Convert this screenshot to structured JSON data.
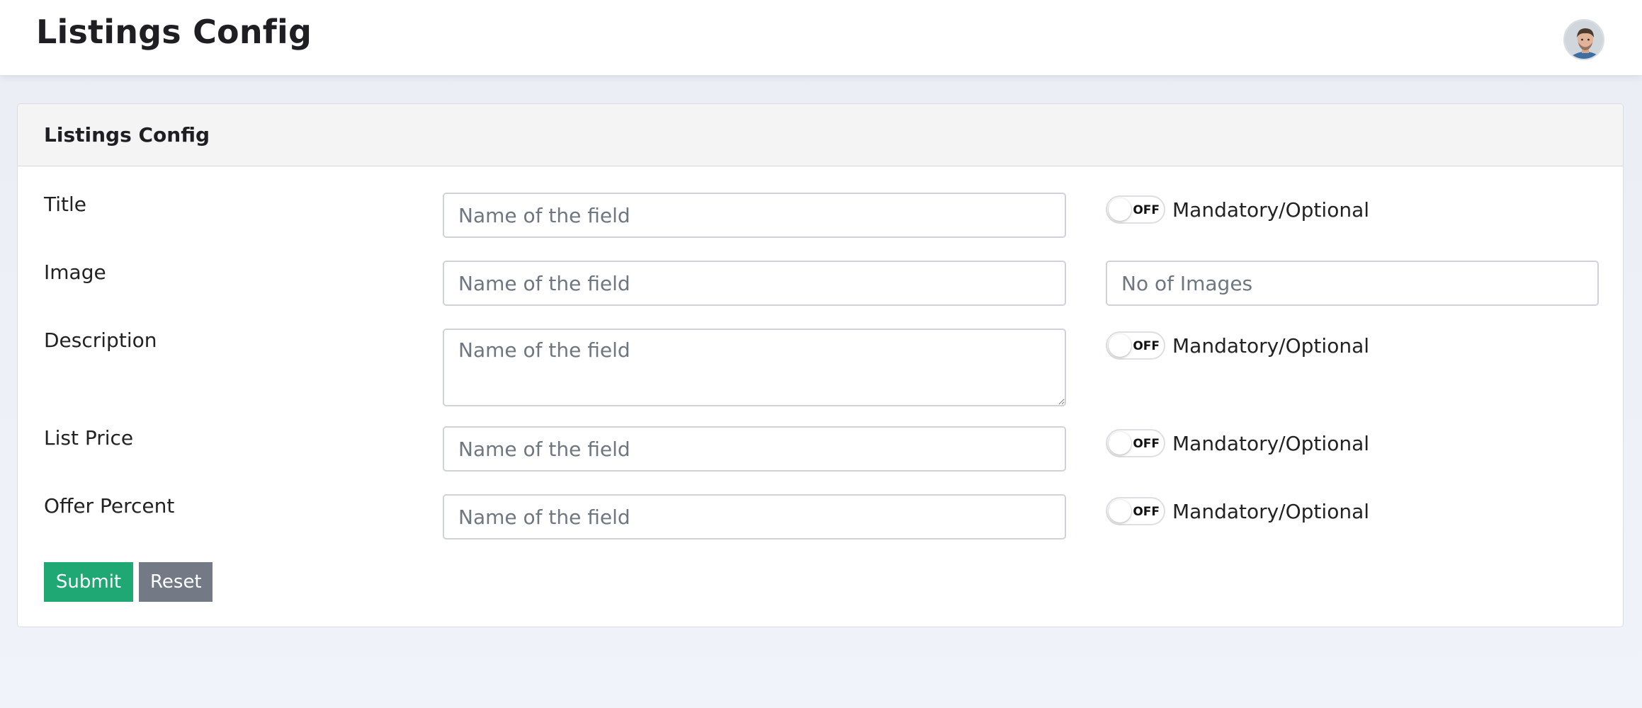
{
  "header": {
    "title": "Listings Config"
  },
  "card": {
    "title": "Listings Config"
  },
  "form": {
    "rows": [
      {
        "label": "Title",
        "placeholder": "Name of the field",
        "toggle_state": "OFF",
        "toggle_label": "Mandatory/Optional"
      },
      {
        "label": "Image",
        "placeholder": "Name of the field",
        "images_placeholder": "No of Images"
      },
      {
        "label": "Description",
        "placeholder": "Name of the field",
        "toggle_state": "OFF",
        "toggle_label": "Mandatory/Optional"
      },
      {
        "label": "List Price",
        "placeholder": "Name of the field",
        "toggle_state": "OFF",
        "toggle_label": "Mandatory/Optional"
      },
      {
        "label": "Offer Percent",
        "placeholder": "Name of the field",
        "toggle_state": "OFF",
        "toggle_label": "Mandatory/Optional"
      }
    ],
    "submit_label": "Submit",
    "reset_label": "Reset"
  },
  "colors": {
    "submit": "#1fa774",
    "reset": "#737a85",
    "card_header_bg": "#f4f4f4",
    "page_bg": "#eef0f8"
  },
  "icons": {
    "avatar": "user-avatar"
  }
}
